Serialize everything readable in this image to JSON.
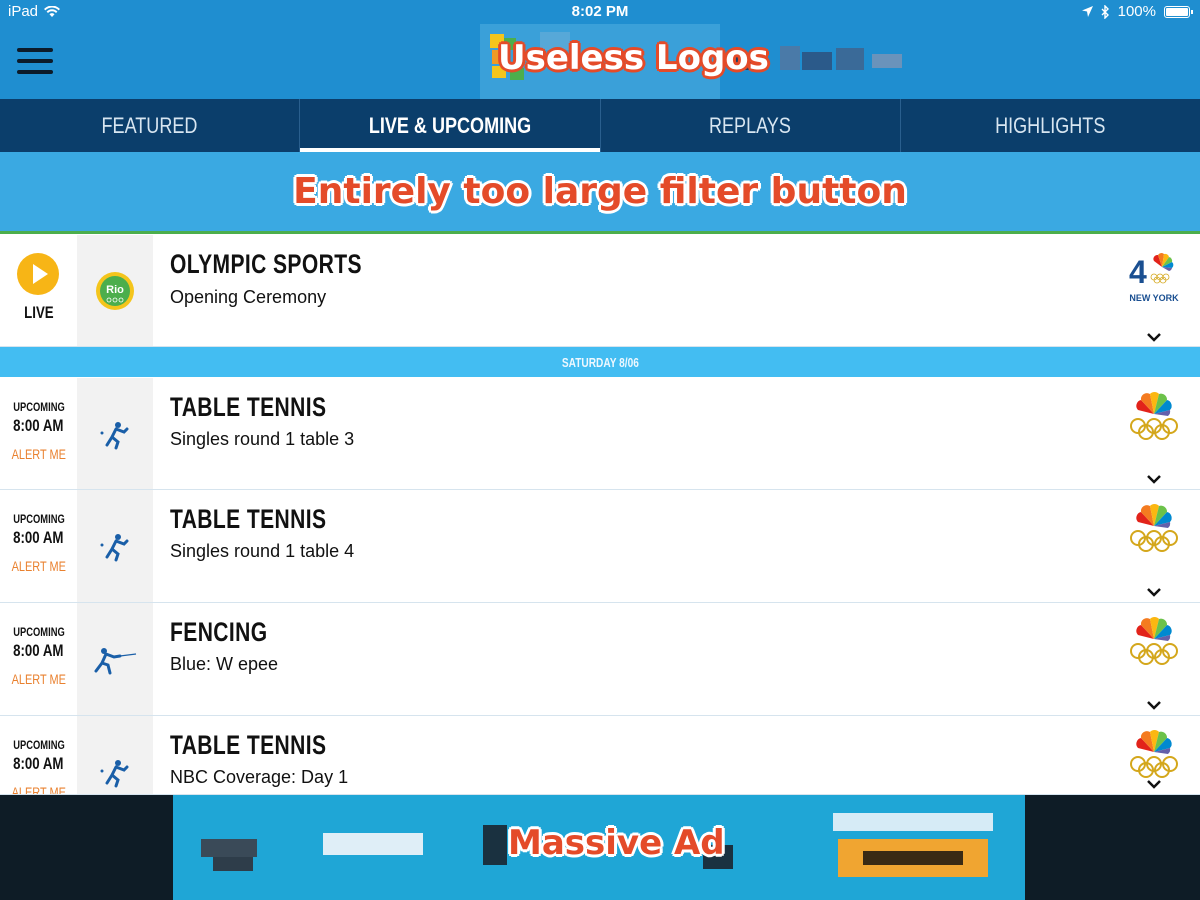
{
  "status_bar": {
    "device": "iPad",
    "time": "8:02 PM",
    "battery": "100%"
  },
  "header": {
    "annotation": "Useless Logos"
  },
  "tabs": [
    {
      "label": "FEATURED",
      "active": false
    },
    {
      "label": "LIVE & UPCOMING",
      "active": true
    },
    {
      "label": "REPLAYS",
      "active": false
    },
    {
      "label": "HIGHLIGHTS",
      "active": false
    }
  ],
  "filter": {
    "annotation": "Entirely too large filter button"
  },
  "live_row": {
    "status": "LIVE",
    "sport": "OLYMPIC SPORTS",
    "event": "Opening Ceremony",
    "sport_icon": "rio-logo-icon",
    "network": "NBC 4 NEW YORK",
    "network_text": "NEW YORK"
  },
  "date_divider": "SATURDAY 8/06",
  "rows": [
    {
      "status": "UPCOMING",
      "time": "8:00 AM",
      "alert": "ALERT ME",
      "sport": "TABLE TENNIS",
      "event": "Singles round 1 table 3",
      "sport_icon": "table-tennis-icon",
      "network": "nbc-olympics-logo"
    },
    {
      "status": "UPCOMING",
      "time": "8:00 AM",
      "alert": "ALERT ME",
      "sport": "TABLE TENNIS",
      "event": "Singles round 1 table 4",
      "sport_icon": "table-tennis-icon",
      "network": "nbc-olympics-logo"
    },
    {
      "status": "UPCOMING",
      "time": "8:00 AM",
      "alert": "ALERT ME",
      "sport": "FENCING",
      "event": "Blue: W epee",
      "sport_icon": "fencing-icon",
      "network": "nbc-olympics-logo"
    },
    {
      "status": "UPCOMING",
      "time": "8:00 AM",
      "alert": "ALERT ME",
      "sport": "TABLE TENNIS",
      "event": "NBC Coverage: Day 1",
      "sport_icon": "table-tennis-icon",
      "network": "nbc-olympics-logo"
    }
  ],
  "ad": {
    "annotation": "Massive Ad"
  },
  "colors": {
    "header_blue": "#1f8ed0",
    "tab_navy": "#0b3e6b",
    "filter_blue": "#3aa9e2",
    "divider_blue": "#43bdf2",
    "alert_orange": "#e9812f",
    "annotation_red": "#e44b29",
    "ad_blue": "#1fa6d6"
  }
}
